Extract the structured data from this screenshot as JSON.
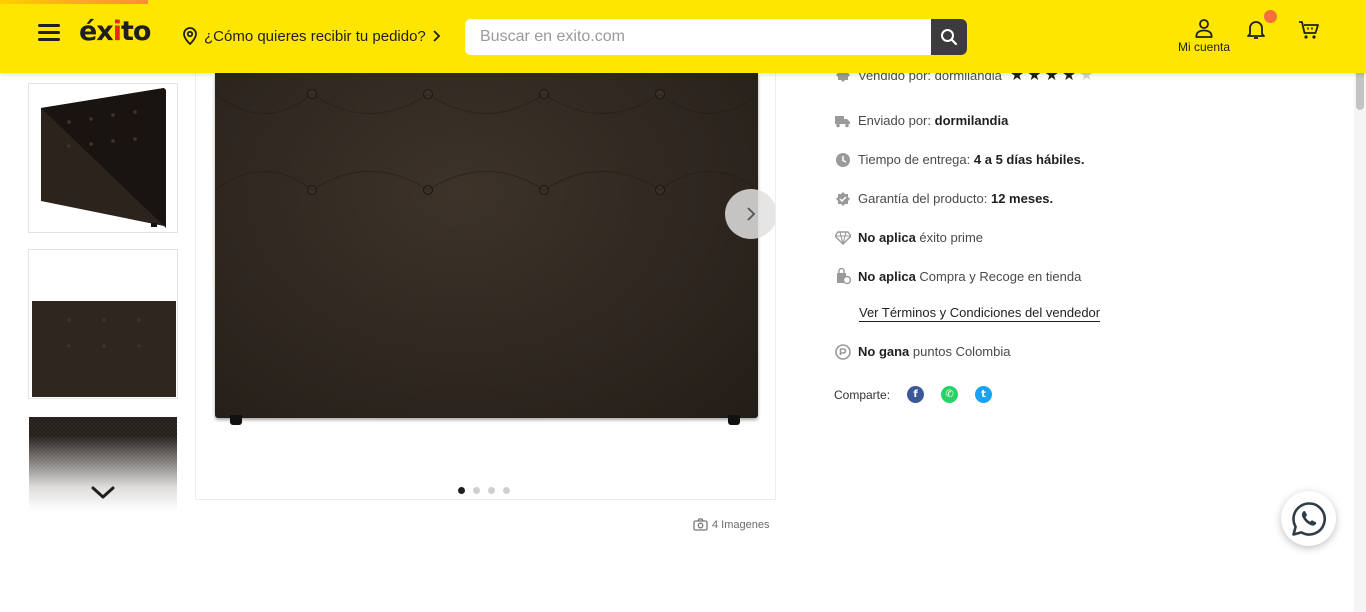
{
  "header": {
    "logo_text": "éxito",
    "location_prompt": "¿Cómo quieres recibir tu pedido?",
    "search_placeholder": "Buscar en exito.com",
    "account_label": "Mi cuenta",
    "brand_color": "#ffe600",
    "notification_color": "#f3703a",
    "icons": [
      "menu-icon",
      "location-pin-icon",
      "chevron-right-icon",
      "search-icon",
      "user-icon",
      "bell-icon",
      "cart-icon"
    ]
  },
  "gallery": {
    "image_count_label": "4 Imagenes",
    "slide_count": 4,
    "active_slide": 1,
    "thumbnails": [
      "headboard-angled",
      "headboard-front",
      "fabric-detail"
    ]
  },
  "details": {
    "sold_by_label": "Vendido por:",
    "sold_by_value": "dormilandia",
    "seller_rating": 4,
    "seller_rating_max": 5,
    "shipped_by_label": "Enviado por:",
    "shipped_by_value": "dormilandia",
    "delivery_label": "Tiempo de entrega:",
    "delivery_value": "4 a 5 días hábiles.",
    "warranty_label": "Garantía del producto:",
    "warranty_value": "12 meses.",
    "prime_status": "No aplica",
    "prime_label": "éxito prime",
    "pickup_status": "No aplica",
    "pickup_label": "Compra y Recoge en tienda",
    "terms_link": "Ver Términos y Condiciones del vendedor",
    "points_status": "No gana",
    "points_label": "puntos Colombia",
    "share_label": "Comparte:",
    "share_networks": [
      {
        "name": "facebook",
        "color": "#3b5998",
        "glyph": "f"
      },
      {
        "name": "whatsapp",
        "color": "#25d366",
        "glyph": "✆"
      },
      {
        "name": "twitter",
        "color": "#1da1f2",
        "glyph": "t"
      }
    ]
  }
}
